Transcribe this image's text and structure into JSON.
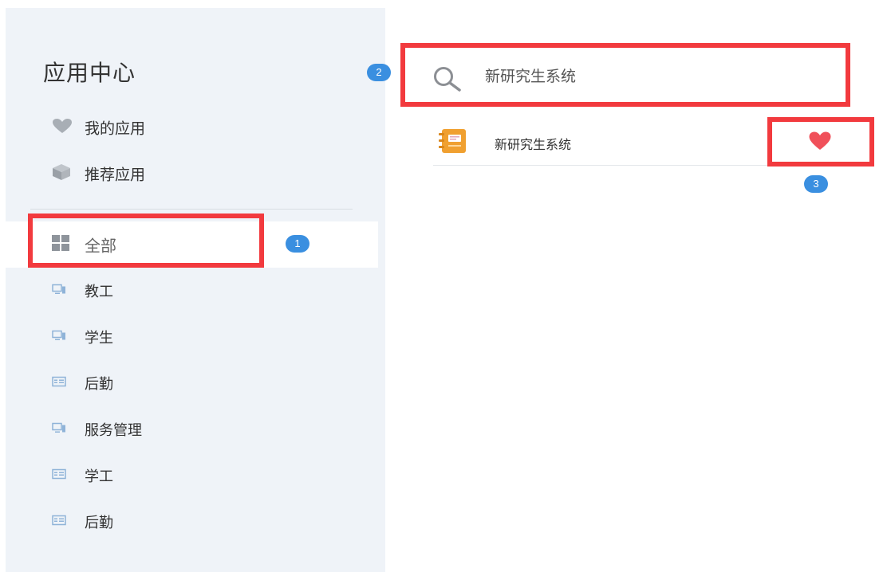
{
  "sidebar": {
    "title": "应用中心",
    "top_items": [
      {
        "label": "我的应用",
        "icon": "heart-icon"
      },
      {
        "label": "推荐应用",
        "icon": "cube-icon"
      }
    ],
    "categories": [
      {
        "label": "全部",
        "icon": "grid-icon",
        "active": true
      },
      {
        "label": "教工",
        "icon": "monitor-icon"
      },
      {
        "label": "学生",
        "icon": "monitor-icon"
      },
      {
        "label": "后勤",
        "icon": "list-icon"
      },
      {
        "label": "服务管理",
        "icon": "monitor-icon"
      },
      {
        "label": "学工",
        "icon": "list-icon"
      },
      {
        "label": "后勤",
        "icon": "list-icon"
      }
    ]
  },
  "search": {
    "value": "新研究生系统",
    "icon": "search-icon"
  },
  "results": [
    {
      "name": "新研究生系统",
      "icon": "notebook-icon",
      "favorited": true
    }
  ],
  "annotations": {
    "badges": [
      "1",
      "2",
      "3"
    ]
  },
  "colors": {
    "sidebar_bg": "#eff3f8",
    "highlight": "#f23a3e",
    "badge": "#3a8fe0",
    "favorite": "#f0505a",
    "app_icon": "#f0a030"
  }
}
